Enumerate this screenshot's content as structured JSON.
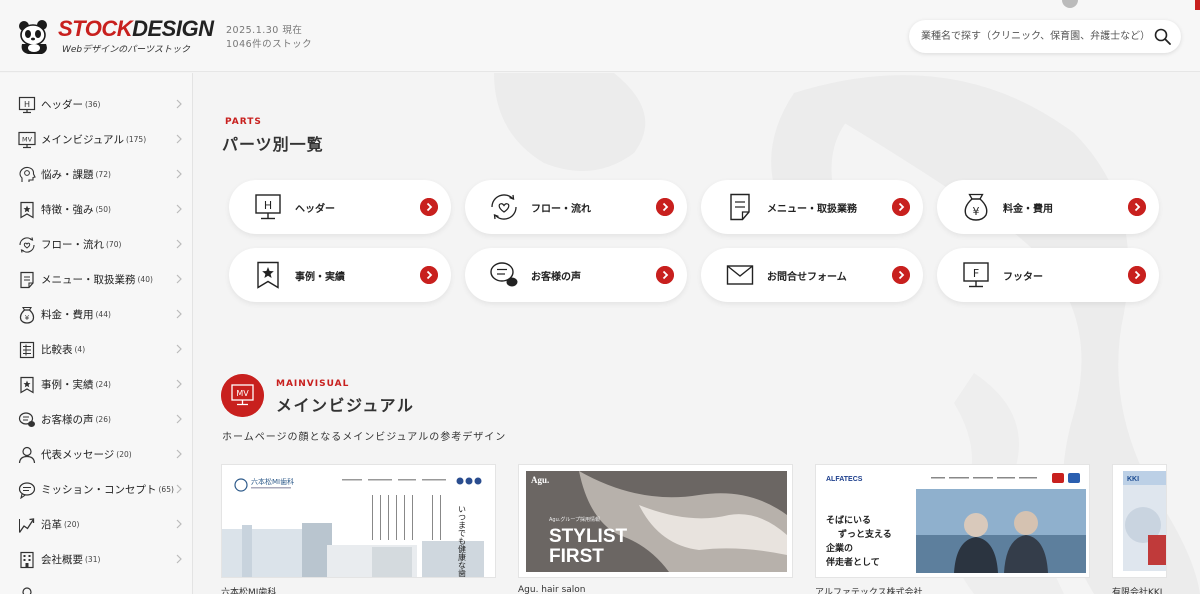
{
  "header": {
    "logo_stock": "STOCK",
    "logo_design": "DESIGN",
    "logo_sub": "Webデザインのパーツストック",
    "date": "2025.1.30 現在",
    "count": "1046件のストック",
    "search_placeholder": "業種名で探す（クリニック、保育園、弁護士など）"
  },
  "sidebar": {
    "items": [
      {
        "label": "ヘッダー",
        "count": "(36)",
        "icon": "header-icon"
      },
      {
        "label": "メインビジュアル",
        "count": "(175)",
        "icon": "mv-icon"
      },
      {
        "label": "悩み・課題",
        "count": "(72)",
        "icon": "worry-icon"
      },
      {
        "label": "特徴・強み",
        "count": "(50)",
        "icon": "feature-icon"
      },
      {
        "label": "フロー・流れ",
        "count": "(70)",
        "icon": "flow-icon"
      },
      {
        "label": "メニュー・取扱業務",
        "count": "(40)",
        "icon": "menu-icon"
      },
      {
        "label": "料金・費用",
        "count": "(44)",
        "icon": "price-icon"
      },
      {
        "label": "比較表",
        "count": "(4)",
        "icon": "compare-icon"
      },
      {
        "label": "事例・実績",
        "count": "(24)",
        "icon": "case-icon"
      },
      {
        "label": "お客様の声",
        "count": "(26)",
        "icon": "voice-icon"
      },
      {
        "label": "代表メッセージ",
        "count": "(20)",
        "icon": "person-icon"
      },
      {
        "label": "ミッション・コンセプト",
        "count": "(65)",
        "icon": "mission-icon"
      },
      {
        "label": "沿革",
        "count": "(20)",
        "icon": "history-icon"
      },
      {
        "label": "会社概要",
        "count": "(31)",
        "icon": "company-icon"
      }
    ]
  },
  "parts": {
    "eyebrow": "PARTS",
    "title": "パーツ別一覧",
    "cards": [
      {
        "label": "ヘッダー",
        "icon": "header-icon"
      },
      {
        "label": "フロー・流れ",
        "icon": "flow-icon"
      },
      {
        "label": "メニュー・取扱業務",
        "icon": "menu-icon"
      },
      {
        "label": "料金・費用",
        "icon": "price-icon"
      },
      {
        "label": "事例・実績",
        "icon": "case-icon"
      },
      {
        "label": "お客様の声",
        "icon": "voice-icon"
      },
      {
        "label": "お問合せフォーム",
        "icon": "mail-icon"
      },
      {
        "label": "フッター",
        "icon": "footer-icon"
      }
    ]
  },
  "mainvisual": {
    "eyebrow": "MAINVISUAL",
    "title": "メインビジュアル",
    "desc": "ホームページの顔となるメインビジュアルの参考デザイン",
    "thumbs": [
      {
        "caption": "六本松MI歯科",
        "logo": "六本松MI歯科",
        "headline": "いつまでも健康な歯を守る"
      },
      {
        "caption": "Agu. hair salon",
        "logo": "Agu.",
        "headline1": "STYLIST",
        "headline2": "FIRST",
        "sub": "Agu.グループ採用情報"
      },
      {
        "caption": "アルファテックス株式会社",
        "logo": "ALFATECS",
        "copy1": "そばにいる",
        "copy2": "ずっと支える",
        "copy3": "企業の",
        "copy4": "伴走者として"
      },
      {
        "caption": "有限会社KKI",
        "logo": "KKI"
      }
    ]
  },
  "colors": {
    "accent": "#c8201e"
  }
}
